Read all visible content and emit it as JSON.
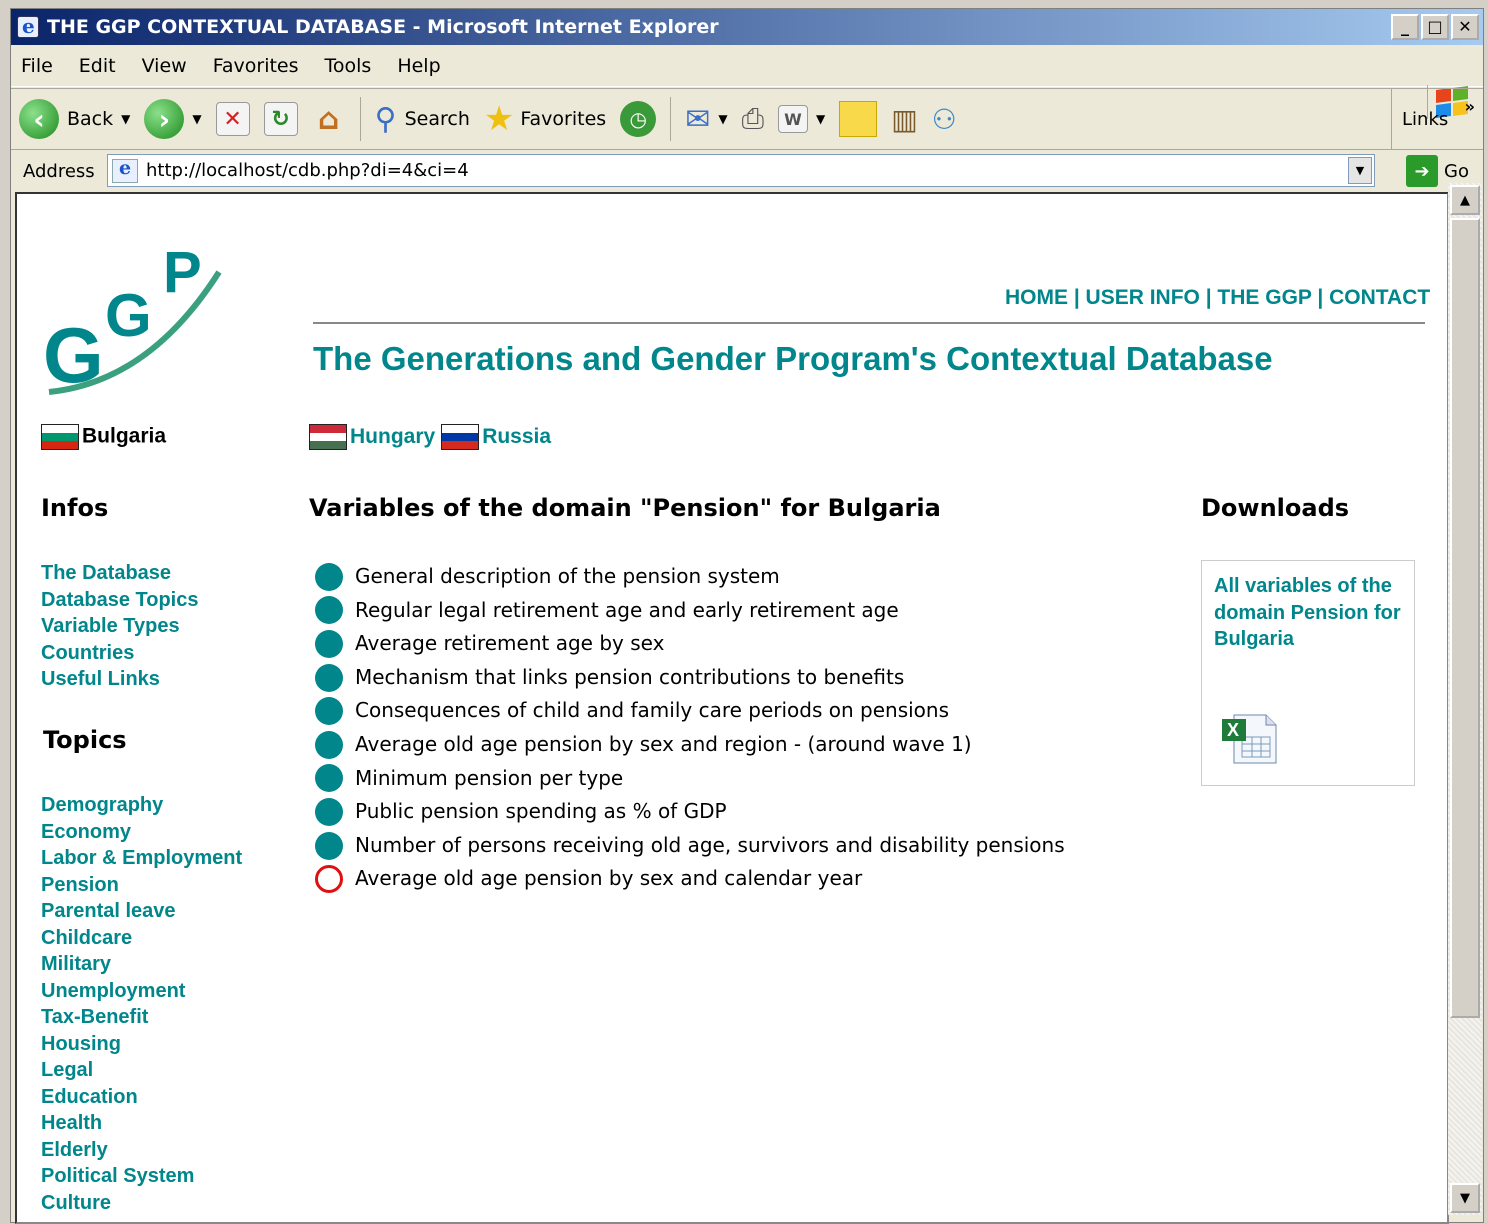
{
  "window": {
    "title": "THE GGP CONTEXTUAL DATABASE - Microsoft Internet Explorer"
  },
  "menu": [
    "File",
    "Edit",
    "View",
    "Favorites",
    "Tools",
    "Help"
  ],
  "toolbar": {
    "back": "Back",
    "search": "Search",
    "favorites": "Favorites",
    "links": "Links"
  },
  "address": {
    "label": "Address",
    "url": "http://localhost/cdb.php?di=4&ci=4",
    "go": "Go"
  },
  "nav": {
    "text": "HOME | USER INFO | THE GGP | CONTACT"
  },
  "page": {
    "heading": "The Generations and Gender Program's Contextual Database"
  },
  "countries": {
    "current": "Bulgaria",
    "others": [
      "Hungary",
      "Russia"
    ]
  },
  "infos": {
    "title": "Infos",
    "links": [
      "The Database",
      "Database Topics",
      "Variable Types",
      "Countries",
      "Useful Links"
    ]
  },
  "topics": {
    "title": "Topics",
    "links": [
      "Demography",
      "Economy",
      "Labor & Employment",
      "Pension",
      "Parental leave",
      "Childcare",
      "Military",
      "Unemployment",
      "Tax-Benefit",
      "Housing",
      "Legal",
      "Education",
      "Health",
      "Elderly",
      "Political System",
      "Culture"
    ]
  },
  "variables": {
    "title": "Variables of the domain \"Pension\" for Bulgaria",
    "items": [
      {
        "label": "General description of the pension system",
        "available": true
      },
      {
        "label": "Regular legal retirement age and early retirement age",
        "available": true
      },
      {
        "label": "Average retirement age by sex",
        "available": true
      },
      {
        "label": "Mechanism that links pension contributions to benefits",
        "available": true
      },
      {
        "label": "Consequences of child and family care periods on pensions",
        "available": true
      },
      {
        "label": "Average old age pension by sex and region - (around wave 1)",
        "available": true
      },
      {
        "label": "Minimum pension per type",
        "available": true
      },
      {
        "label": "Public pension spending as % of GDP",
        "available": true
      },
      {
        "label": "Number of persons receiving old age, survivors and disability pensions",
        "available": true
      },
      {
        "label": "Average old age pension by sex and calendar year",
        "available": false
      }
    ]
  },
  "downloads": {
    "title": "Downloads",
    "link": "All variables of the domain Pension for Bulgaria"
  },
  "colors": {
    "teal": "#00868b",
    "missing": "#e01010"
  }
}
